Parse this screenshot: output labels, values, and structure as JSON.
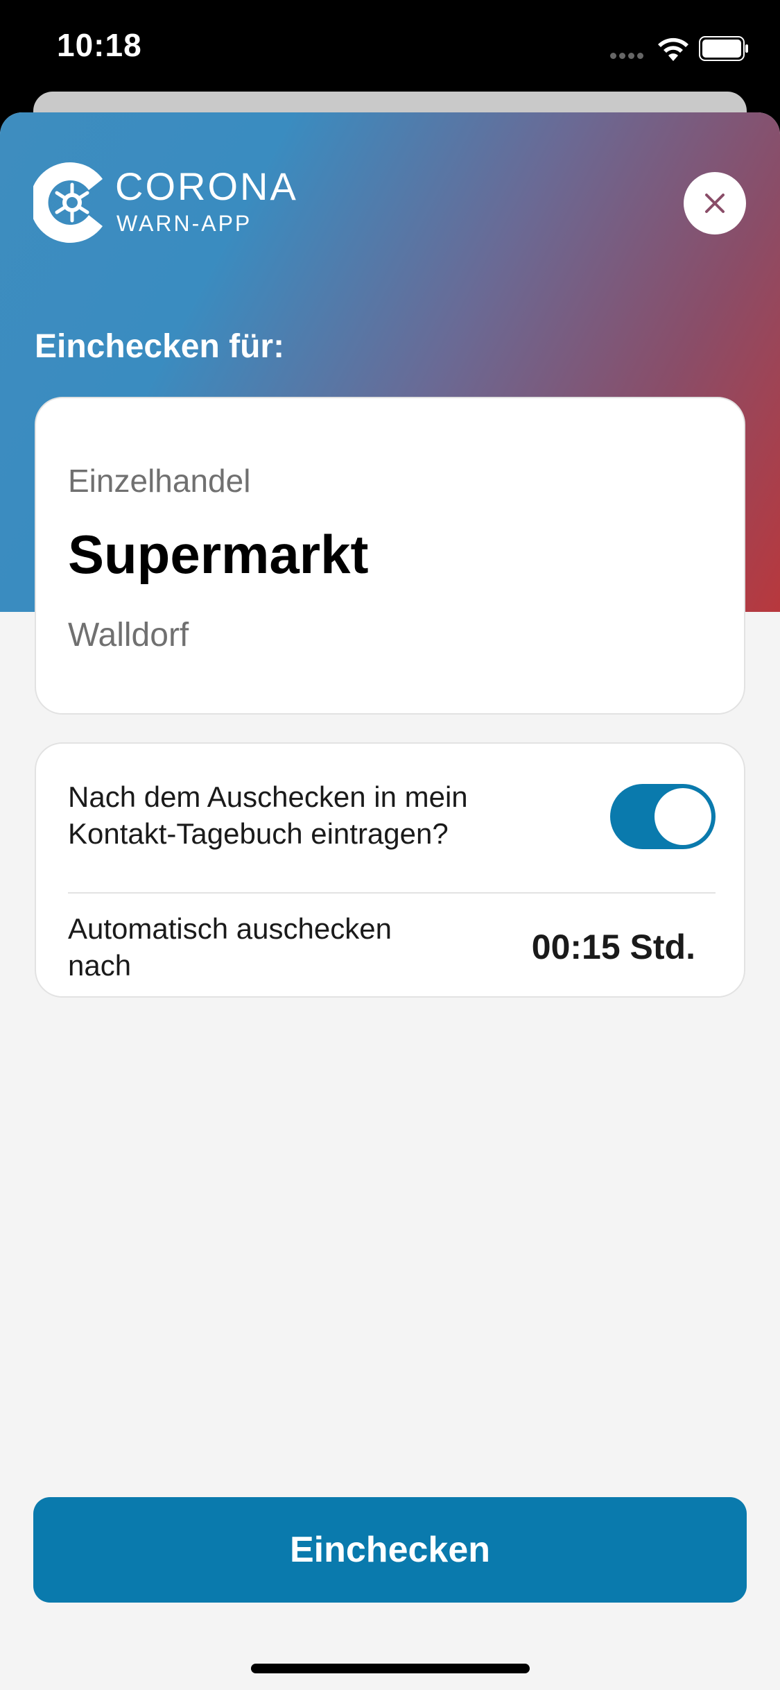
{
  "status_bar": {
    "time": "10:18"
  },
  "app": {
    "logo_line1": "CORONA",
    "logo_line2": "WARN-APP",
    "brand_color": "#0a7aad"
  },
  "checkin": {
    "heading": "Einchecken für:",
    "location": {
      "type": "Einzelhandel",
      "name": "Supermarkt",
      "place": "Walldorf"
    },
    "options": {
      "diary_question": "Nach dem Auschecken in mein Kontakt-Tagebuch eintragen?",
      "diary_toggle_on": true,
      "auto_checkout_label": "Automatisch auschecken nach",
      "auto_checkout_value": "00:15 Std."
    },
    "button_label": "Einchecken"
  }
}
